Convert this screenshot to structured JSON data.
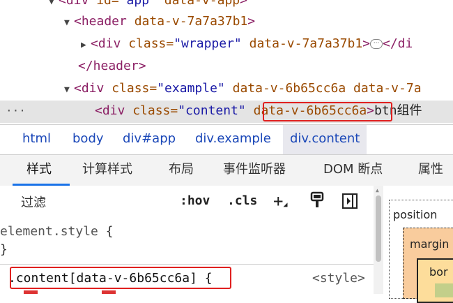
{
  "dom_tree": {
    "line0": {
      "tri": "▼",
      "open": "<div",
      "attr1": " id=",
      "val1": "\"app\"",
      "attr2": " data-v-app",
      "close": ">"
    },
    "line1": {
      "tri": "▼",
      "open": "<header",
      "attr1": " data-v-7a7a37b1",
      "close": ">"
    },
    "line2": {
      "tri": "▶",
      "open": "<div",
      "attr1": " class=",
      "val1": "\"wrapper\"",
      "attr2": " data-v-7a7a37b1",
      "close": ">",
      "ellipsis": "···",
      "end": "</di"
    },
    "line3": {
      "text": "</header>"
    },
    "line4": {
      "tri": "▼",
      "open": "<div",
      "attr1": " class=",
      "val1": "\"example\"",
      "attr2": " data-v-6b65cc6a",
      "attr3": " data-v-7a"
    },
    "line5": {
      "gutter": "···",
      "open": "<div",
      "attr1": " class=",
      "val1": "\"content\"",
      "attr2": "data-v-6b65cc6a",
      "close": ">",
      "text": "btn组件"
    }
  },
  "breadcrumbs": [
    "html",
    "body",
    "div#app",
    "div.example",
    "div.content"
  ],
  "tabs": [
    "样式",
    "计算样式",
    "布局",
    "事件监听器",
    "DOM 断点",
    "属性"
  ],
  "styles": {
    "filter_placeholder": "过滤",
    "hov": ":hov",
    "cls": ".cls",
    "plus": "+",
    "rule1_selector": "element.style",
    "rule1_open": " {",
    "rule1_close": "}",
    "rule2_selector": ".content[data-v-6b65cc6a]",
    "rule2_open": " {",
    "rule2_source": "<style>"
  },
  "box_model": {
    "position": "position",
    "margin": "margin",
    "border": "bor"
  },
  "colors": {
    "highlight": "#e0201f",
    "tab_accent": "#1a73e8"
  }
}
